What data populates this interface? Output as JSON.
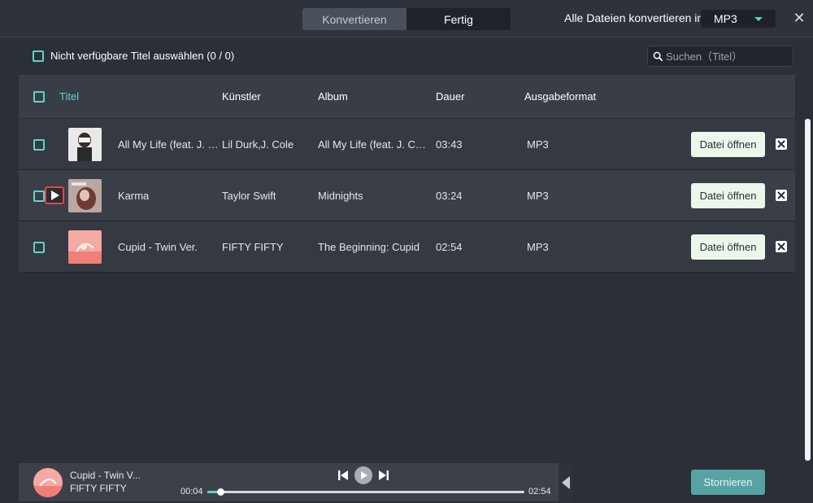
{
  "header": {
    "tabs": [
      {
        "label": "Konvertieren",
        "active": false
      },
      {
        "label": "Fertig",
        "active": true
      }
    ],
    "convert_all_label": "Alle Dateien konvertieren in :",
    "format_selected": "MP3"
  },
  "toolbar": {
    "select_unavailable_label": "Nicht verfügbare Titel auswählen (0 / 0)",
    "search_placeholder": "Suchen（Titel）"
  },
  "table": {
    "columns": [
      "Titel",
      "Künstler",
      "Album",
      "Dauer",
      "Ausgabeformat"
    ],
    "rows": [
      {
        "title": "All My Life (feat. J. Cole)",
        "artist": "Lil Durk,J. Cole",
        "album": "All My Life (feat. J. Cole)",
        "duration": "03:43",
        "format": "MP3",
        "open_label": "Datei öffnen"
      },
      {
        "title": "Karma",
        "artist": "Taylor Swift",
        "album": "Midnights",
        "duration": "03:24",
        "format": "MP3",
        "open_label": "Datei öffnen"
      },
      {
        "title": "Cupid - Twin Ver.",
        "artist": "FIFTY FIFTY",
        "album": "The Beginning: Cupid",
        "duration": "02:54",
        "format": "MP3",
        "open_label": "Datei öffnen"
      }
    ]
  },
  "player": {
    "title": "Cupid - Twin V...",
    "artist": "FIFTY FIFTY",
    "current_time": "00:04",
    "total_time": "02:54",
    "progress": 0.04
  },
  "footer": {
    "cancel_label": "Stornieren"
  },
  "colors": {
    "accent": "#5ed3c9",
    "background": "#2b2f37",
    "highlight_red": "#e04646"
  }
}
